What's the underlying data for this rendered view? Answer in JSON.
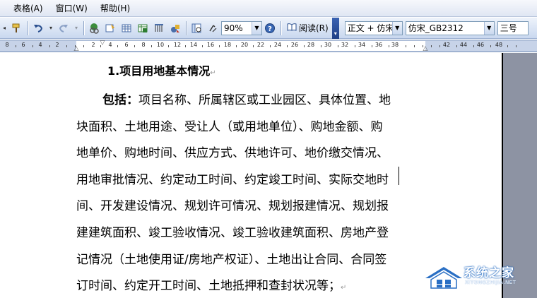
{
  "menu": {
    "items": [
      {
        "label": "表格(A)"
      },
      {
        "label": "窗口(W)"
      },
      {
        "label": "帮助(H)"
      }
    ]
  },
  "toolbar": {
    "zoom": "90%",
    "read_label": "阅读(R)",
    "style": "正文 + 仿宋",
    "font": "仿宋_GB2312",
    "size": "三号",
    "icons": [
      "format-painter-icon",
      "undo-icon",
      "redo-icon",
      "hyperlink-icon",
      "tables-borders-icon",
      "insert-table-icon",
      "insert-excel-icon",
      "columns-icon",
      "drawing-icon",
      "document-map-icon",
      "show-hide-icon",
      "help-icon",
      "read-icon"
    ]
  },
  "ruler": {
    "labels": [
      "8",
      "6",
      "4",
      "2",
      "2",
      "4",
      "6",
      "8",
      "10",
      "12",
      "14",
      "16",
      "18",
      "20",
      "22",
      "24",
      "26",
      "28",
      "30",
      "32",
      "34",
      "36",
      "38",
      "42",
      "44",
      "46",
      "48"
    ]
  },
  "document": {
    "heading": "1.项目用地基本情况",
    "label": "包括：",
    "lines": [
      "项目名称、所属辖区或工业园区、具体位置、地",
      "块面积、土地用途、受让人（或用地单位）、购地金额、购",
      "地单价、购地时间、供应方式、供地许可、地价缴交情况、",
      "用地审批情况、约定动工时间、约定竣工时间、实际交地时",
      "间、开发建设情况、规划许可情况、规划报建情况、规划报",
      "建建筑面积、竣工验收情况、竣工验收建筑面积、房地产登",
      "记情况（土地使用证/房地产权证）、土地出让合同、合同签",
      "订时间、约定开工时间、土地抵押和查封状况等；"
    ],
    "paragraph_mark": "↵"
  },
  "watermark": {
    "title": "系统之家",
    "subtitle": "XITONGZHIJIA.NET"
  }
}
